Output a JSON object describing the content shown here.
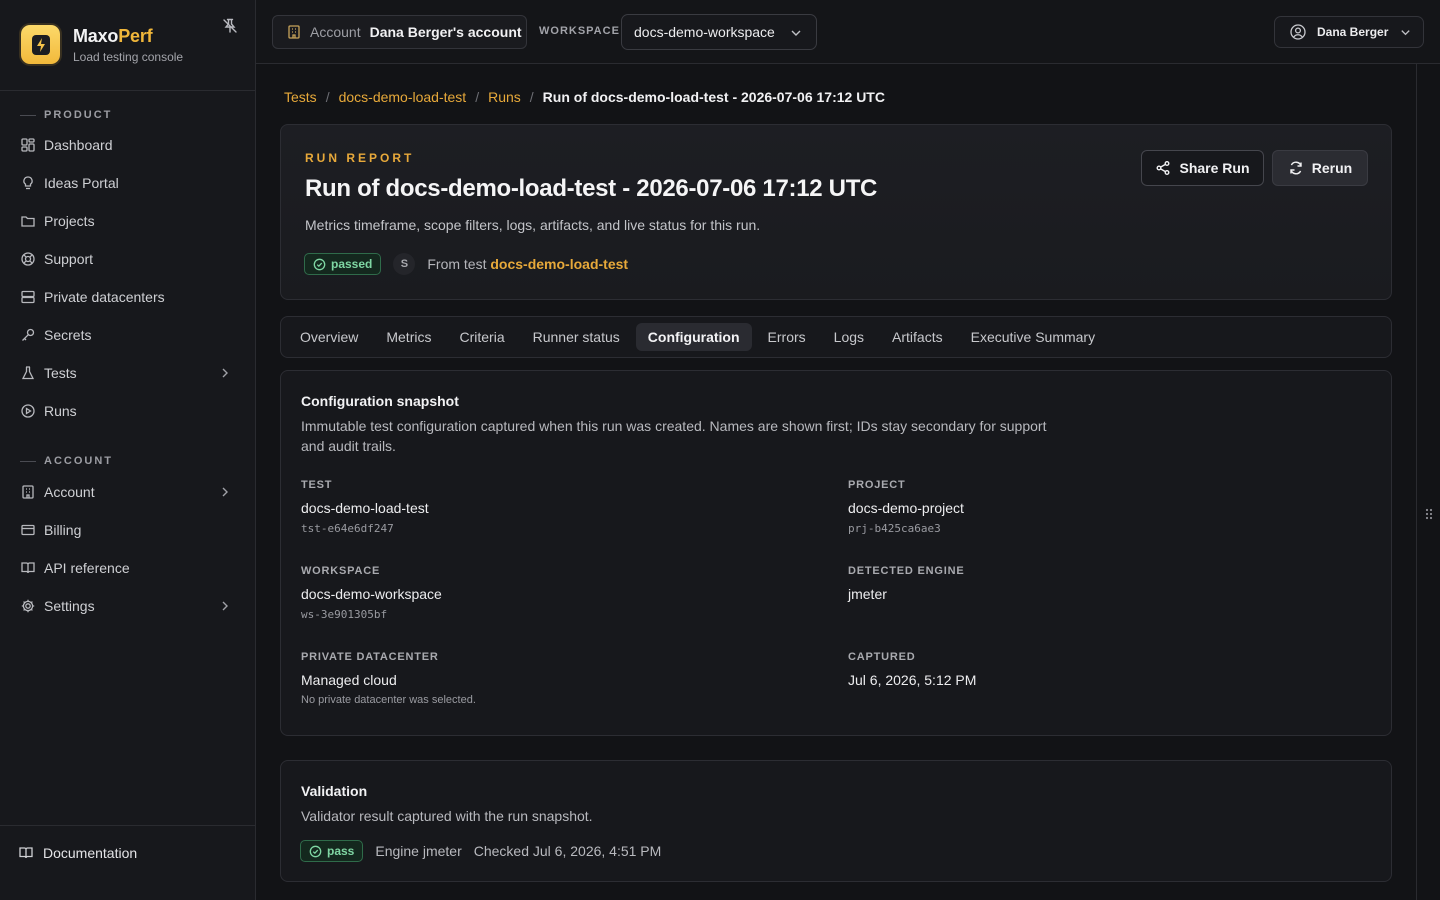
{
  "brand": {
    "name_main": "Maxo",
    "name_accent": "Perf",
    "subtitle": "Load testing console"
  },
  "sidebar": {
    "product_label": "PRODUCT",
    "account_label": "ACCOUNT",
    "product_items": [
      {
        "label": "Dashboard",
        "icon": "dashboard-icon"
      },
      {
        "label": "Ideas Portal",
        "icon": "lightbulb-icon"
      },
      {
        "label": "Projects",
        "icon": "folder-icon"
      },
      {
        "label": "Support",
        "icon": "lifebuoy-icon"
      },
      {
        "label": "Private datacenters",
        "icon": "server-icon"
      },
      {
        "label": "Secrets",
        "icon": "key-icon"
      },
      {
        "label": "Tests",
        "icon": "flask-icon",
        "has_children": true
      },
      {
        "label": "Runs",
        "icon": "play-circle-icon"
      }
    ],
    "account_items": [
      {
        "label": "Account",
        "icon": "building-icon",
        "has_children": true
      },
      {
        "label": "Billing",
        "icon": "credit-card-icon"
      },
      {
        "label": "API reference",
        "icon": "book-icon"
      },
      {
        "label": "Settings",
        "icon": "gear-icon",
        "has_children": true
      }
    ],
    "documentation_label": "Documentation"
  },
  "topbar": {
    "account_label": "Account",
    "account_value": "Dana Berger's account",
    "workspace_label": "WORKSPACE",
    "workspace_value": "docs-demo-workspace",
    "user_name": "Dana Berger"
  },
  "breadcrumb": {
    "items": [
      "Tests",
      "docs-demo-load-test",
      "Runs"
    ],
    "current": "Run of docs-demo-load-test - 2026-07-06 17:12 UTC"
  },
  "header": {
    "eyebrow": "RUN REPORT",
    "title": "Run of docs-demo-load-test - 2026-07-06 17:12 UTC",
    "description": "Metrics timeframe, scope filters, logs, artifacts, and live status for this run.",
    "status": "passed",
    "avatar_initial": "S",
    "from_test_prefix": "From test",
    "from_test_link": "docs-demo-load-test",
    "share_label": "Share Run",
    "rerun_label": "Rerun"
  },
  "tabs": {
    "items": [
      "Overview",
      "Metrics",
      "Criteria",
      "Runner status",
      "Configuration",
      "Errors",
      "Logs",
      "Artifacts",
      "Executive Summary"
    ],
    "active": "Configuration"
  },
  "config": {
    "title": "Configuration snapshot",
    "description": "Immutable test configuration captured when this run was created. Names are shown first; IDs stay secondary for support and audit trails.",
    "test": {
      "label": "TEST",
      "value": "docs-demo-load-test",
      "id": "tst-e64e6df247"
    },
    "project": {
      "label": "PROJECT",
      "value": "docs-demo-project",
      "id": "prj-b425ca6ae3"
    },
    "workspace": {
      "label": "WORKSPACE",
      "value": "docs-demo-workspace",
      "id": "ws-3e901305bf"
    },
    "engine": {
      "label": "DETECTED ENGINE",
      "value": "jmeter"
    },
    "datacenter": {
      "label": "PRIVATE DATACENTER",
      "value": "Managed cloud",
      "note": "No private datacenter was selected."
    },
    "captured": {
      "label": "CAPTURED",
      "value": "Jul 6, 2026, 5:12 PM"
    }
  },
  "validation": {
    "title": "Validation",
    "description": "Validator result captured with the run snapshot.",
    "status": "pass",
    "engine": "Engine jmeter",
    "checked": "Checked Jul 6, 2026, 4:51 PM"
  },
  "colors": {
    "accent": "#e7a93a",
    "background": "#121316",
    "success": "#7fd6a3"
  }
}
